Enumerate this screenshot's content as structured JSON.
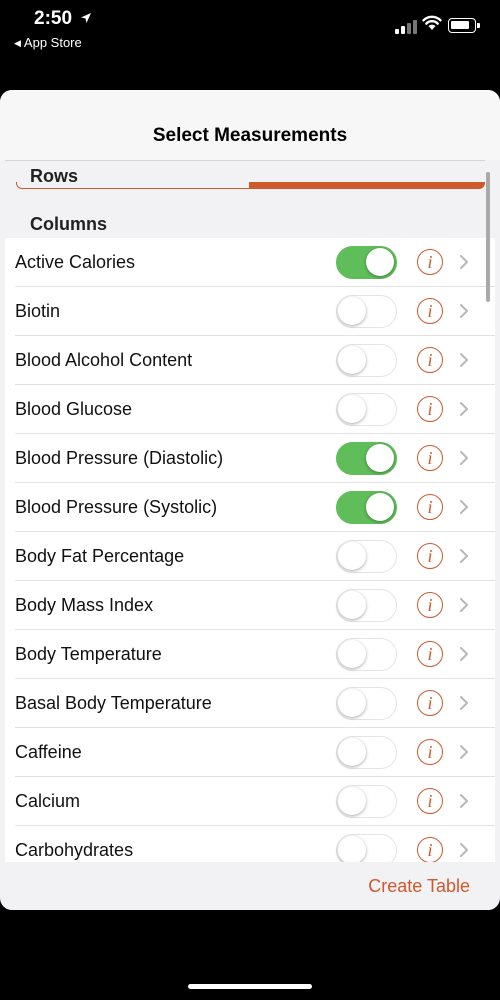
{
  "status_bar": {
    "time": "2:50",
    "back_app": "App Store"
  },
  "sheet": {
    "title": "Select Measurements",
    "rows_header": "Rows",
    "columns_header": "Columns",
    "create_button": "Create Table"
  },
  "colors": {
    "accent": "#cc5a2c",
    "toggle_on": "#5fbd5a"
  },
  "info_glyph": "i",
  "measurements": [
    {
      "label": "Active Calories",
      "enabled": true
    },
    {
      "label": "Biotin",
      "enabled": false
    },
    {
      "label": "Blood Alcohol Content",
      "enabled": false
    },
    {
      "label": "Blood Glucose",
      "enabled": false
    },
    {
      "label": "Blood Pressure (Diastolic)",
      "enabled": true
    },
    {
      "label": "Blood Pressure (Systolic)",
      "enabled": true
    },
    {
      "label": "Body Fat Percentage",
      "enabled": false
    },
    {
      "label": "Body Mass Index",
      "enabled": false
    },
    {
      "label": "Body Temperature",
      "enabled": false
    },
    {
      "label": "Basal Body Temperature",
      "enabled": false
    },
    {
      "label": "Caffeine",
      "enabled": false
    },
    {
      "label": "Calcium",
      "enabled": false
    },
    {
      "label": "Carbohydrates",
      "enabled": false
    }
  ]
}
